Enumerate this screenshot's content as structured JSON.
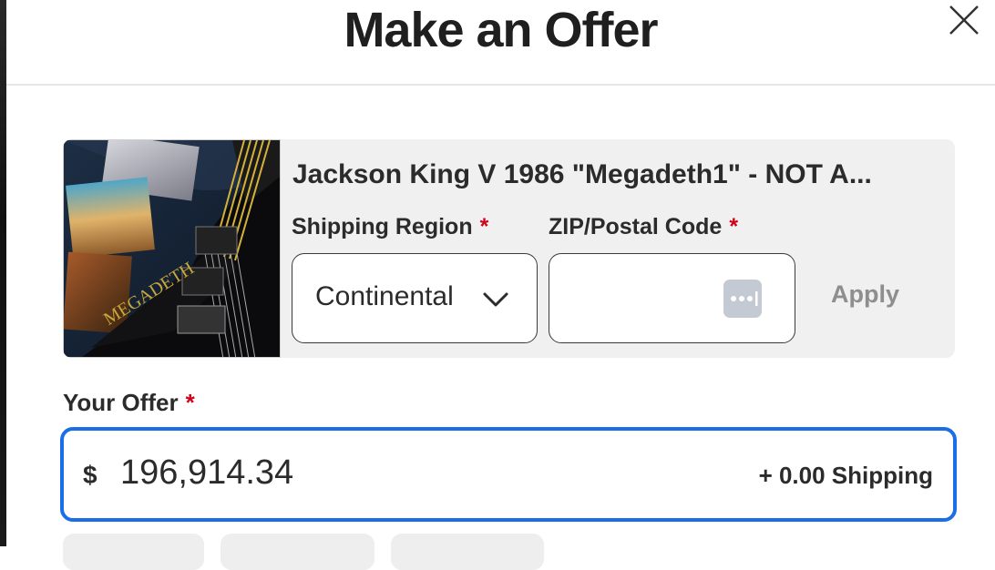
{
  "modal": {
    "title": "Make an Offer"
  },
  "listing": {
    "title": "Jackson King V 1986 \"Megadeth1\" - NOT A...",
    "image_text": "MEGADETH"
  },
  "shipping": {
    "region_label": "Shipping Region",
    "region_value": "Continental",
    "zip_label": "ZIP/Postal Code",
    "zip_value": "",
    "required_mark": "*",
    "apply_label": "Apply"
  },
  "offer": {
    "label": "Your Offer",
    "currency_symbol": "$",
    "amount": "196,914.34",
    "shipping_note": "+ 0.00 Shipping"
  },
  "colors": {
    "accent": "#1a6ee8",
    "required": "#d0021b",
    "card_bg": "#f0f0f0",
    "disabled_text": "#8e8e8e"
  },
  "icons": [
    "close-icon",
    "chevron-down-icon",
    "password-manager-icon"
  ]
}
